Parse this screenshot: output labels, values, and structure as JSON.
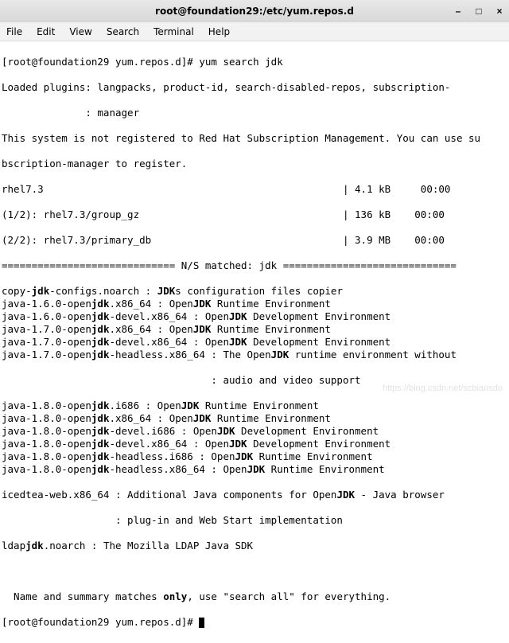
{
  "window": {
    "title": "root@foundation29:/etc/yum.repos.d"
  },
  "menubar": {
    "items": [
      "File",
      "Edit",
      "View",
      "Search",
      "Terminal",
      "Help"
    ]
  },
  "prompt": {
    "user_host": "[root@foundation29 yum.repos.d]# ",
    "command": "yum search jdk"
  },
  "output": {
    "plugins_line": "Loaded plugins: langpacks, product-id, search-disabled-repos, subscription-",
    "plugins_cont": "              : manager",
    "not_registered": "This system is not registered to Red Hat Subscription Management. You can use su",
    "not_registered2": "bscription-manager to register.",
    "repo_line": "rhel7.3                                                  | 4.1 kB     00:00",
    "prog1": "(1/2): rhel7.3/group_gz                                  | 136 kB    00:00",
    "prog2": "(2/2): rhel7.3/primary_db                                | 3.9 MB    00:00",
    "match_header": "============================= N/S matched: jdk =============================",
    "packages": [
      {
        "pre": "copy-",
        "b1": "jdk",
        "mid": "-configs.noarch : ",
        "b2": "JDK",
        "post": "s configuration files copier"
      },
      {
        "pre": "java-1.6.0-open",
        "b1": "jdk",
        "mid": ".x86_64 : Open",
        "b2": "JDK",
        "post": " Runtime Environment"
      },
      {
        "pre": "java-1.6.0-open",
        "b1": "jdk",
        "mid": "-devel.x86_64 : Open",
        "b2": "JDK",
        "post": " Development Environment"
      },
      {
        "pre": "java-1.7.0-open",
        "b1": "jdk",
        "mid": ".x86_64 : Open",
        "b2": "JDK",
        "post": " Runtime Environment"
      },
      {
        "pre": "java-1.7.0-open",
        "b1": "jdk",
        "mid": "-devel.x86_64 : Open",
        "b2": "JDK",
        "post": " Development Environment"
      },
      {
        "pre": "java-1.7.0-open",
        "b1": "jdk",
        "mid": "-headless.x86_64 : The Open",
        "b2": "JDK",
        "post": " runtime environment without"
      }
    ],
    "headless_cont": "                                   : audio and video support",
    "packages2": [
      {
        "pre": "java-1.8.0-open",
        "b1": "jdk",
        "mid": ".i686 : Open",
        "b2": "JDK",
        "post": " Runtime Environment"
      },
      {
        "pre": "java-1.8.0-open",
        "b1": "jdk",
        "mid": ".x86_64 : Open",
        "b2": "JDK",
        "post": " Runtime Environment"
      },
      {
        "pre": "java-1.8.0-open",
        "b1": "jdk",
        "mid": "-devel.i686 : Open",
        "b2": "JDK",
        "post": " Development Environment"
      },
      {
        "pre": "java-1.8.0-open",
        "b1": "jdk",
        "mid": "-devel.x86_64 : Open",
        "b2": "JDK",
        "post": " Development Environment"
      },
      {
        "pre": "java-1.8.0-open",
        "b1": "jdk",
        "mid": "-headless.i686 : Open",
        "b2": "JDK",
        "post": " Runtime Environment"
      },
      {
        "pre": "java-1.8.0-open",
        "b1": "jdk",
        "mid": "-headless.x86_64 : Open",
        "b2": "JDK",
        "post": " Runtime Environment"
      }
    ],
    "icedtea": {
      "pre": "icedtea-web.x86_64 : Additional Java components for Open",
      "b": "JDK",
      "post": " - Java browser"
    },
    "icedtea_cont": "                   : plug-in and Web Start implementation",
    "ldap": {
      "pre": "ldap",
      "b": "jdk",
      "post": ".noarch : The Mozilla LDAP Java SDK"
    },
    "summary": {
      "pre": "  Name and summary matches ",
      "b": "only",
      "post": ", use \"search all\" for everything."
    }
  },
  "watermark": "https://blog.csdn.net/scbiaosdo"
}
